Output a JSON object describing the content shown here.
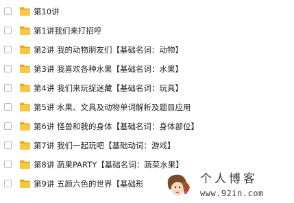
{
  "rows": [
    {
      "label": "第10讲"
    },
    {
      "label": "第1讲我们来打招呼"
    },
    {
      "label": "第2讲 我的动物朋友们【基础名词：动物】"
    },
    {
      "label": "第3讲 我喜欢各种水果【基础名词：水果】"
    },
    {
      "label": "第4讲 我们来玩捉迷藏【基础名词：玩具】"
    },
    {
      "label": "第5讲 水果、文具及动物单词解析及题目应用"
    },
    {
      "label": "第6讲 怪兽和我的身体【基础名词：身体部位】"
    },
    {
      "label": "第7讲 我们一起玩吧【基础动词：游戏】"
    },
    {
      "label": "第8讲 蔬果PARTY【基础名词：蔬菜水果】"
    },
    {
      "label": "第9讲 五颜六色的世界【基础形"
    }
  ],
  "watermark": {
    "title": "个人博客",
    "url": "www.92in.com"
  },
  "colors": {
    "folder": "#f7c844",
    "folder_tab": "#e8a812",
    "checkbox_border": "#b9b9b9",
    "text": "#222222"
  },
  "icons": {
    "checkbox": "checkbox-icon",
    "folder": "folder-icon",
    "avatar": "cartoon-avatar-icon"
  }
}
